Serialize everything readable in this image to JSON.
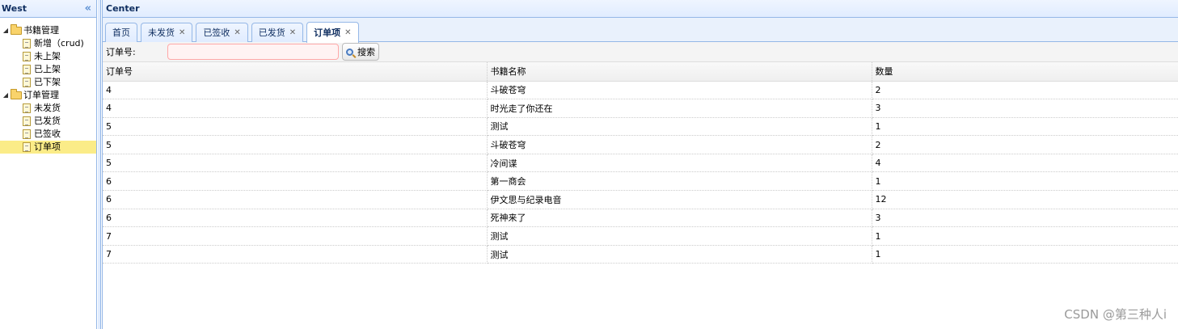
{
  "west": {
    "title": "West",
    "tree": [
      {
        "label": "书籍管理",
        "children": [
          "新增（crud)",
          "未上架",
          "已上架",
          "已下架"
        ]
      },
      {
        "label": "订单管理",
        "children": [
          "未发货",
          "已发货",
          "已签收",
          "订单项"
        ]
      }
    ]
  },
  "center": {
    "title": "Center",
    "tabs": [
      {
        "label": "首页",
        "closable": false
      },
      {
        "label": "未发货",
        "closable": true
      },
      {
        "label": "已签收",
        "closable": true
      },
      {
        "label": "已发货",
        "closable": true
      },
      {
        "label": "订单项",
        "closable": true,
        "active": true
      }
    ],
    "toolbar": {
      "order_label": "订单号:",
      "order_value": "",
      "search_label": "搜索"
    },
    "grid": {
      "columns": [
        "订单号",
        "书籍名称",
        "数量"
      ],
      "rows": [
        [
          "4",
          "斗破苍穹",
          "2"
        ],
        [
          "4",
          "时光走了你还在",
          "3"
        ],
        [
          "5",
          "测试",
          "1"
        ],
        [
          "5",
          "斗破苍穹",
          "2"
        ],
        [
          "5",
          "冷间谍",
          "4"
        ],
        [
          "6",
          "第一商会",
          "1"
        ],
        [
          "6",
          "伊文思与纪录电音",
          "12"
        ],
        [
          "6",
          "死神来了",
          "3"
        ],
        [
          "7",
          "测试",
          "1"
        ],
        [
          "7",
          "测试",
          "1"
        ]
      ]
    }
  },
  "watermark": "CSDN @第三种人i"
}
